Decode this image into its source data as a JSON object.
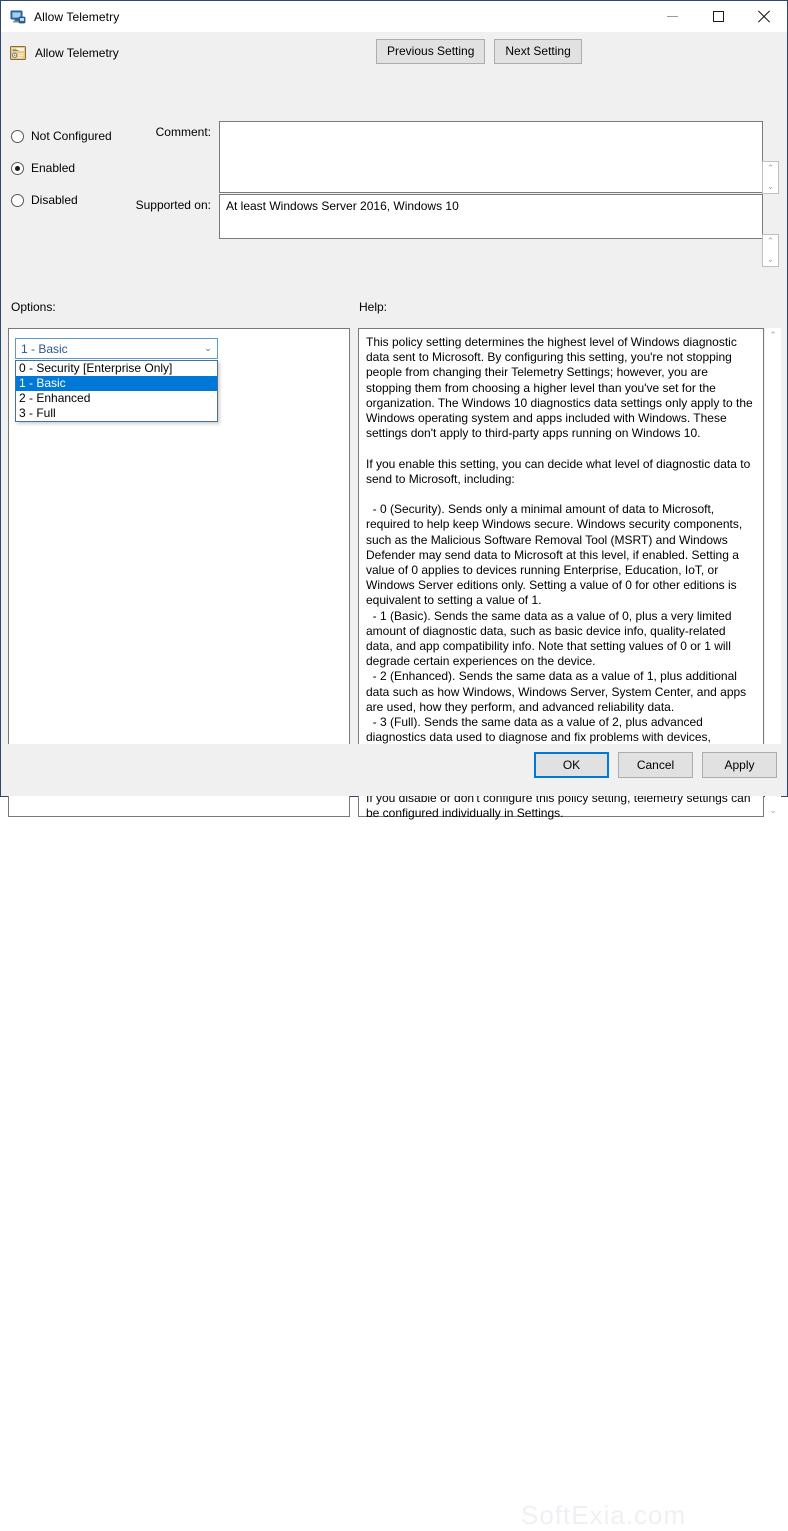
{
  "window": {
    "title": "Allow Telemetry",
    "icon": "computer-policy-icon",
    "minimize_label": "Minimize",
    "maximize_label": "Maximize",
    "close_label": "Close"
  },
  "header": {
    "title": "Allow Telemetry",
    "icon": "policy-setting-icon",
    "previous_label": "Previous Setting",
    "next_label": "Next Setting"
  },
  "state": {
    "options": [
      {
        "label": "Not Configured",
        "selected": false
      },
      {
        "label": "Enabled",
        "selected": true
      },
      {
        "label": "Disabled",
        "selected": false
      }
    ]
  },
  "comment": {
    "label": "Comment:",
    "value": "",
    "scroll_up": "⌃",
    "scroll_down": "⌄"
  },
  "supported_on": {
    "label": "Supported on:",
    "value": "At least Windows Server 2016, Windows 10",
    "scroll_up": "⌃",
    "scroll_down": "⌄"
  },
  "panes": {
    "options_label": "Options:",
    "help_label": "Help:"
  },
  "combo": {
    "name": "telemetry-level-select",
    "selected": "1 - Basic",
    "arrow": "⌄",
    "expanded": true,
    "items": [
      {
        "label": "0 - Security [Enterprise Only]",
        "selected": false
      },
      {
        "label": "1 - Basic",
        "selected": true
      },
      {
        "label": "2 - Enhanced",
        "selected": false
      },
      {
        "label": "3 - Full",
        "selected": false
      }
    ]
  },
  "help": {
    "scroll_up": "⌃",
    "scroll_down": "⌄",
    "text": "This policy setting determines the highest level of Windows diagnostic data sent to Microsoft. By configuring this setting, you're not stopping people from changing their Telemetry Settings; however, you are stopping them from choosing a higher level than you've set for the organization. The Windows 10 diagnostics data settings only apply to the Windows operating system and apps included with Windows. These settings don't apply to third-party apps running on Windows 10.\n\nIf you enable this setting, you can decide what level of diagnostic data to send to Microsoft, including:\n\n  - 0 (Security). Sends only a minimal amount of data to Microsoft, required to help keep Windows secure. Windows security components, such as the Malicious Software Removal Tool (MSRT) and Windows Defender may send data to Microsoft at this level, if enabled. Setting a value of 0 applies to devices running Enterprise, Education, IoT, or Windows Server editions only. Setting a value of 0 for other editions is equivalent to setting a value of 1.\n  - 1 (Basic). Sends the same data as a value of 0, plus a very limited amount of diagnostic data, such as basic device info, quality-related data, and app compatibility info. Note that setting values of 0 or 1 will degrade certain experiences on the device.\n  - 2 (Enhanced). Sends the same data as a value of 1, plus additional data such as how Windows, Windows Server, System Center, and apps are used, how they perform, and advanced reliability data.\n  - 3 (Full). Sends the same data as a value of 2, plus advanced diagnostics data used to diagnose and fix problems with devices, including the files and content that may have caused a problem with the device.\n\nIf you disable or don't configure this policy setting, telemetry settings can be configured individually in Settings."
  },
  "footer": {
    "ok_label": "OK",
    "cancel_label": "Cancel",
    "apply_label": "Apply"
  },
  "watermark": {
    "text": "SoftExia.com"
  },
  "colors": {
    "accent": "#0078d7",
    "window_bg": "#f0f0f0",
    "field_bg": "#ffffff",
    "border": "#7a7a7a",
    "combo_border": "#5b9bd5",
    "combo_text": "#2b5797"
  }
}
